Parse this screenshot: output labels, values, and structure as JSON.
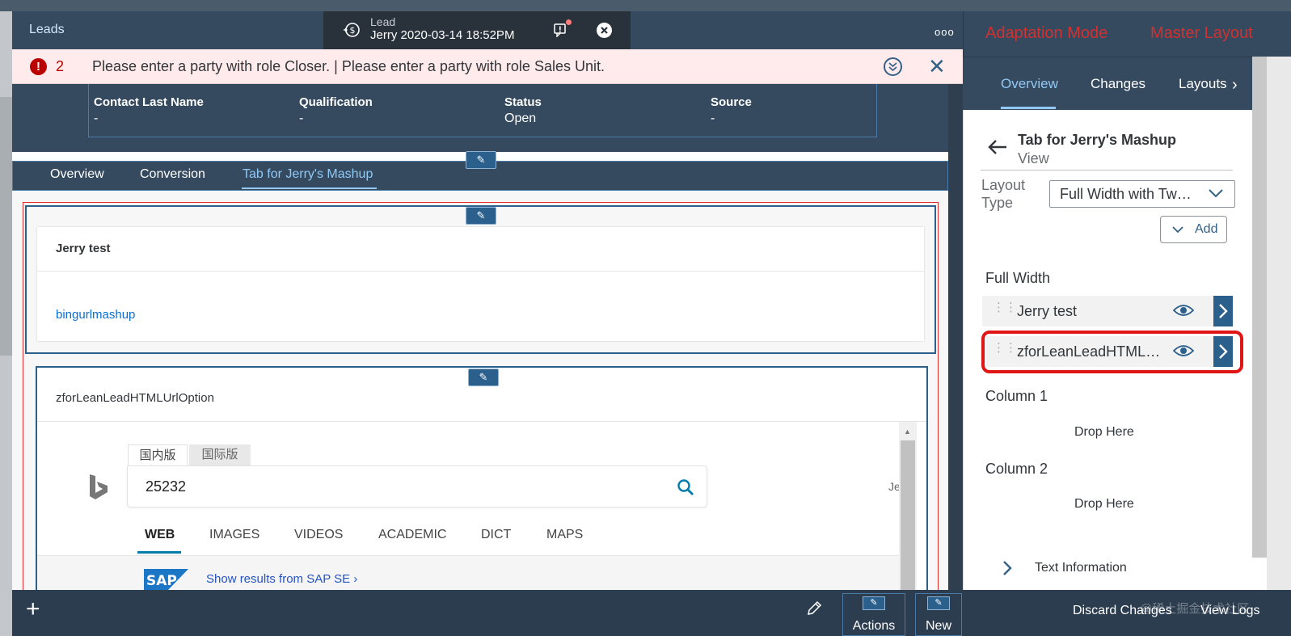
{
  "shell": {
    "home_tab": "Leads",
    "open_tab_type": "Lead",
    "open_tab_title": "Jerry 2020-03-14 18:52PM",
    "more": "ooo"
  },
  "message_strip": {
    "count": "2",
    "text": "Please enter a party with role Closer. | Please enter a party with role Sales Unit."
  },
  "object_header": {
    "fields": [
      {
        "label": "Contact Last Name",
        "value": "-"
      },
      {
        "label": "Qualification",
        "value": "-"
      },
      {
        "label": "Status",
        "value": "Open"
      },
      {
        "label": "Source",
        "value": "-"
      }
    ]
  },
  "tabs": [
    {
      "label": "Overview",
      "active": false
    },
    {
      "label": "Conversion",
      "active": false
    },
    {
      "label": "Tab for Jerry's Mashup",
      "active": true
    }
  ],
  "content": {
    "card1_title": "Jerry test",
    "card1_link": "bingurlmashup",
    "block2_title": "zforLeanLeadHTMLUrlOption"
  },
  "bing": {
    "tab_domestic": "国内版",
    "tab_international": "国际版",
    "query": "25232",
    "user": "Je",
    "nav": [
      "WEB",
      "IMAGES",
      "VIDEOS",
      "ACADEMIC",
      "DICT",
      "MAPS"
    ],
    "active_nav": "WEB",
    "sap_link": "Show results from SAP SE"
  },
  "footer": {
    "add": "+",
    "actions_label": "Actions",
    "new_label": "New"
  },
  "right_panel": {
    "mode_label": "Adaptation Mode",
    "master_layout": "Master Layout",
    "tabs": [
      "Overview",
      "Changes",
      "Layouts"
    ],
    "title": "Tab for Jerry's Mashup",
    "subtitle": "View",
    "layout_type_label": "Layout Type",
    "layout_type_value": "Full Width with Two Columns",
    "add_label": "Add",
    "section_full_width": "Full Width",
    "rows": [
      "Jerry test",
      "zforLeanLeadHTMLUrlOption"
    ],
    "section_column1": "Column 1",
    "drop_here_1": "Drop Here",
    "section_column2": "Column 2",
    "drop_here_2": "Drop Here",
    "text_information": "Text Information",
    "discard_changes": "Discard Changes",
    "view_logs": "View Logs"
  },
  "colors": {
    "shell": "#354a5f",
    "accent": "#91c8f6",
    "error": "#bb0000",
    "adaptation_red": "#d03131",
    "button_blue": "#2b5f8c"
  },
  "watermark": "@稀土掘金技术社区"
}
